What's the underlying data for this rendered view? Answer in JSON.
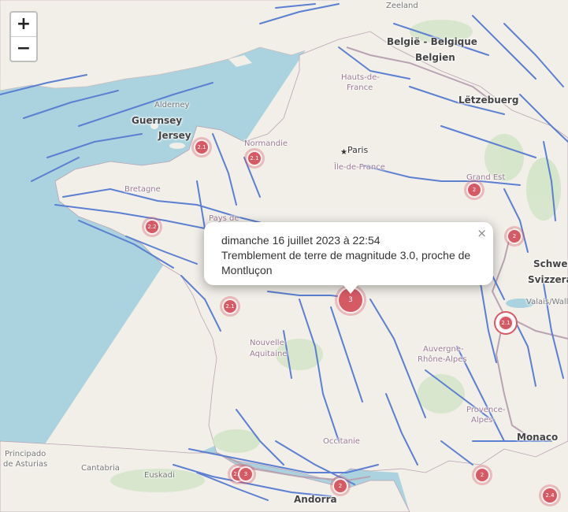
{
  "map": {
    "zoom_in_label": "+",
    "zoom_out_label": "−",
    "colors": {
      "sea": "#aad3df",
      "land": "#f2efe9",
      "fault_lines": "#5b7fd1",
      "marker": "#d65a64",
      "border": "#9b7a92"
    },
    "places": {
      "belgique": "België - Belgique",
      "belgien": "Belgien",
      "letzebuerg": "Lëtzebuerg",
      "hauts_de_france_1": "Hauts-de-",
      "hauts_de_france_2": "France",
      "guernsey": "Guernsey",
      "jersey": "Jersey",
      "alderney": "Alderney",
      "normandie": "Normandie",
      "paris": "Paris",
      "ile_de_france": "Île-de-France",
      "grand_est": "Grand Est",
      "bretagne": "Bretagne",
      "pays_de_loire": "Pays de",
      "schweiz": "Schweiz",
      "svizzera": "Svizzera",
      "nouvelle_aquitaine_1": "Nouvelle-",
      "nouvelle_aquitaine_2": "Aquitaine",
      "auvergne": "Auvergne-",
      "rhone_alpes": "Rhône-Alpes",
      "provence_1": "Provence-",
      "provence_2": "Alpes-",
      "occitanie": "Occitanie",
      "monaco": "Monaco",
      "asturias_1": "Principado",
      "asturias_2": "de Asturias",
      "cantabria": "Cantabria",
      "euskadi": "Euskadi",
      "andorra": "Andorra",
      "island_zeeland": "Zeeland",
      "valais": "Valais/Wallis"
    },
    "markers": [
      {
        "magnitude": "2.1",
        "label": "2.1"
      },
      {
        "magnitude": "2.1",
        "label": "2.1"
      },
      {
        "magnitude": "2",
        "label": "2"
      },
      {
        "magnitude": "2.2",
        "label": "2.2"
      },
      {
        "magnitude": "2",
        "label": "2"
      },
      {
        "magnitude": "3",
        "label": "3"
      },
      {
        "magnitude": "2.1",
        "label": "2.1"
      },
      {
        "magnitude": "2.1",
        "label": "2.1"
      },
      {
        "magnitude": "2.2",
        "label": "2.2"
      },
      {
        "magnitude": "3",
        "label": "3"
      },
      {
        "magnitude": "2",
        "label": "2"
      },
      {
        "magnitude": "2",
        "label": "2"
      },
      {
        "magnitude": "2.4",
        "label": "2.4"
      }
    ],
    "popup": {
      "line1": "dimanche 16 juillet 2023 à 22:54",
      "line2": "Tremblement de terre de magnitude 3.0, proche de",
      "line3": "Montluçon",
      "close_label": "×"
    }
  }
}
